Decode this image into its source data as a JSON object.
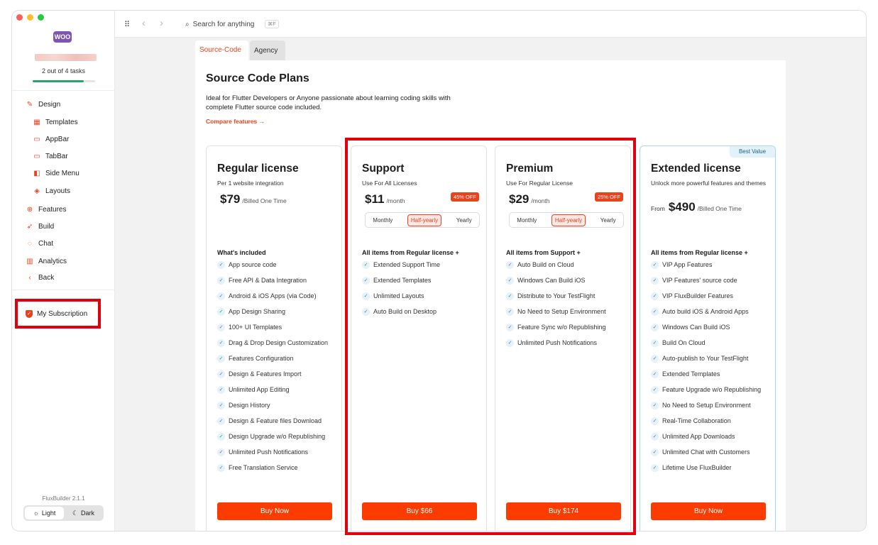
{
  "window": {
    "traffic_lights": {
      "close": "#fe5f57",
      "minimize": "#febc2e",
      "zoom": "#28c840"
    }
  },
  "brand": {
    "logo_text": "WOO",
    "logo_color": "#7f54b3"
  },
  "sidebar": {
    "tasks_text": "2 out of 4 tasks",
    "tasks_progress": 0.82,
    "items": [
      {
        "label": "Design",
        "icon": "pencil-icon"
      },
      {
        "label": "Templates",
        "icon": "grid-icon"
      },
      {
        "label": "AppBar",
        "icon": "appbar-icon"
      },
      {
        "label": "TabBar",
        "icon": "tabbar-icon"
      },
      {
        "label": "Side Menu",
        "icon": "sidemenu-icon"
      },
      {
        "label": "Layouts",
        "icon": "layers-icon"
      },
      {
        "label": "Features",
        "icon": "plus-circle-icon"
      },
      {
        "label": "Build",
        "icon": "rocket-icon"
      },
      {
        "label": "Chat",
        "icon": "chat-icon"
      },
      {
        "label": "Analytics",
        "icon": "bar-chart-icon"
      },
      {
        "label": "Back",
        "icon": "chevron-left-icon"
      }
    ],
    "subscription_label": "My Subscription",
    "version": "FluxBuilder 2.1.1",
    "theme": {
      "light": "Light",
      "dark": "Dark"
    }
  },
  "topbar": {
    "search_placeholder": "Search for anything",
    "shortcut": "⌘F"
  },
  "tabs": [
    "Source-Code",
    "Agency"
  ],
  "page": {
    "title": "Source Code Plans",
    "description": "Ideal for Flutter Developers or Anyone passionate about learning coding skills with complete Flutter source code included.",
    "compare_link": "Compare features →"
  },
  "plans": [
    {
      "name": "Regular license",
      "subtitle": "Per 1 website integration",
      "from": "",
      "price": "$79",
      "price_suffix": "/Billed One Time",
      "features_title": "What's included",
      "features": [
        "App source code",
        "Free API & Data Integration",
        "Android & iOS Apps (via Code)",
        "App Design Sharing",
        "100+ UI Templates",
        "Drag & Drop Design Customization",
        "Features Configuration",
        "Design & Features Import",
        "Unlimited App Editing",
        "Design History",
        "Design & Feature files Download",
        "Design Upgrade w/o Republishing",
        "Unlimited Push Notifications",
        "Free Translation Service"
      ],
      "button": "Buy Now"
    },
    {
      "name": "Support",
      "subtitle": "Use For All Licenses",
      "price": "$11",
      "price_suffix": "/month",
      "discount": "45% OFF",
      "periods": [
        "Monthly",
        "Half-yearly",
        "Yearly"
      ],
      "selected_period": "Half-yearly",
      "features_title": "All items from Regular license +",
      "features": [
        "Extended Support Time",
        "Extended Templates",
        "Unlimited Layouts",
        "Auto Build on Desktop"
      ],
      "button": "Buy $66"
    },
    {
      "name": "Premium",
      "subtitle": "Use For Regular License",
      "price": "$29",
      "price_suffix": "/month",
      "discount": "25% OFF",
      "periods": [
        "Monthly",
        "Half-yearly",
        "Yearly"
      ],
      "selected_period": "Half-yearly",
      "features_title": "All items from Support +",
      "features": [
        "Auto Build on Cloud",
        "Windows Can Build iOS",
        "Distribute to Your TestFlight",
        "No Need to Setup Environment",
        "Feature Sync w/o Republishing",
        "Unlimited Push Notifications"
      ],
      "button": "Buy $174"
    },
    {
      "name": "Extended license",
      "subtitle": "Unlock more powerful features and themes",
      "badge": "Best Value",
      "from": "From",
      "price": "$490",
      "price_suffix": "/Billed One Time",
      "features_title": "All items from Regular license +",
      "features": [
        "VIP App Features",
        "VIP Features' source code",
        "VIP FluxBuilder Features",
        "Auto build iOS & Android Apps",
        "Windows Can Build iOS",
        "Build On Cloud",
        "Auto-publish to Your TestFlight",
        "Extended Templates",
        "Feature Upgrade w/o Republishing",
        "No Need to Setup Environment",
        "Real-Time Collaboration",
        "Unlimited App Downloads",
        "Unlimited Chat with Customers",
        "Lifetime Use FluxBuilder"
      ],
      "button": "Buy Now"
    }
  ],
  "colors": {
    "accent": "#e8431f",
    "buy_button": "#fb3c00",
    "highlight_box": "#e1000e"
  }
}
